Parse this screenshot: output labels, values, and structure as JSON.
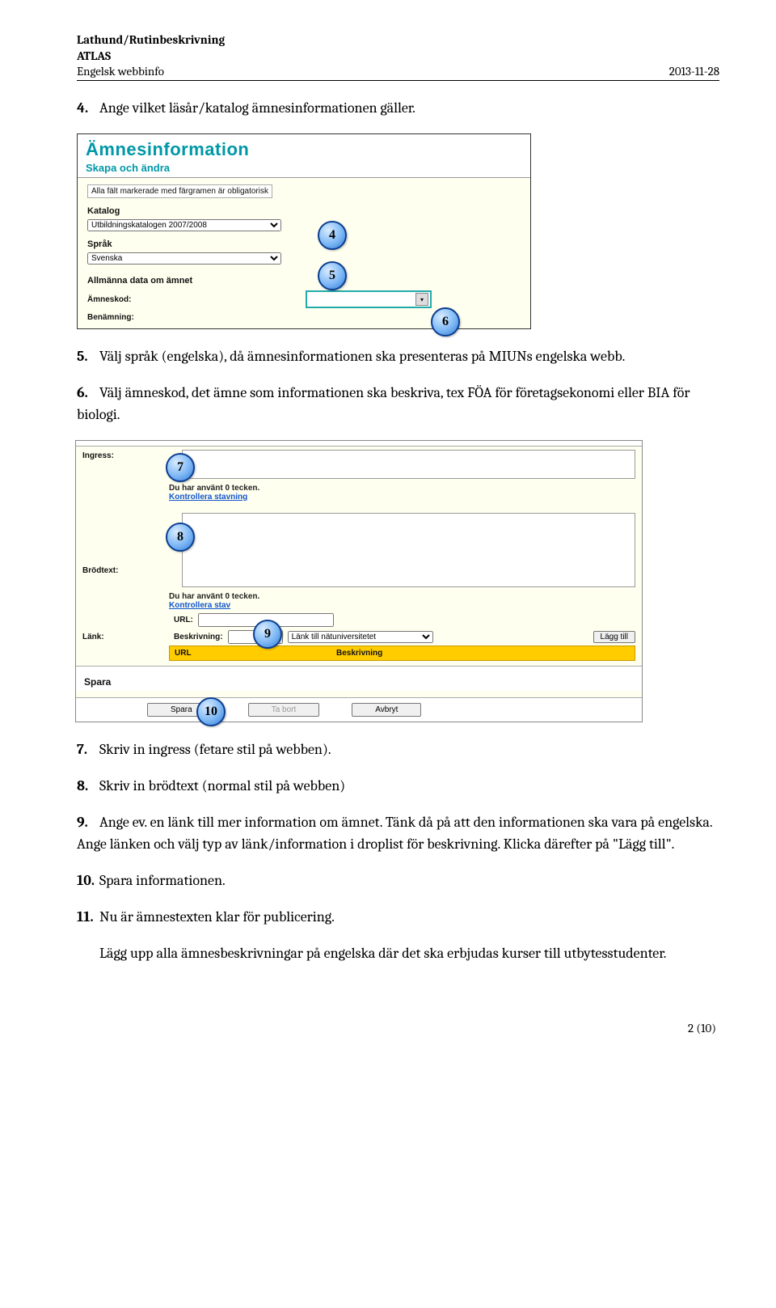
{
  "header": {
    "line1": "Lathund/Rutinbeskrivning",
    "line2": "ATLAS",
    "line3_left": "Engelsk webbinfo",
    "line3_right": "2013-11-28"
  },
  "steps": {
    "s4": {
      "num": "4.",
      "text": "Ange vilket läsår/katalog ämnesinformationen gäller."
    },
    "s5": {
      "num": "5.",
      "text": "Välj språk (engelska), då ämnesinformationen ska presenteras på MIUNs engelska webb."
    },
    "s6": {
      "num": "6.",
      "text": "Välj ämneskod, det ämne som informationen ska beskriva, tex FÖA för företagsekonomi eller BIA för biologi."
    },
    "s7": {
      "num": "7.",
      "text": "Skriv in ingress (fetare stil på webben)."
    },
    "s8": {
      "num": "8.",
      "text": "Skriv in brödtext (normal stil på webben)"
    },
    "s9": {
      "num": "9.",
      "text": "Ange ev. en länk till mer information om ämnet. Tänk då på att den informationen ska vara på engelska. Ange länken och välj typ av länk/information i droplist för beskrivning. Klicka därefter på \"Lägg till\"."
    },
    "s10": {
      "num": "10.",
      "text": "Spara informationen."
    },
    "s11": {
      "num": "11.",
      "text": "Nu är ämnestexten klar för publicering.",
      "para": "Lägg upp alla ämnesbeskrivningar på engelska där det ska erbjudas kurser till utbytesstudenter."
    }
  },
  "markers": {
    "m4": "4",
    "m5": "5",
    "m6": "6",
    "m7": "7",
    "m8": "8",
    "m9": "9",
    "m10": "10"
  },
  "ss1": {
    "title": "Ämnesinformation",
    "subtitle": "Skapa och ändra",
    "mandatory_note": "Alla fält markerade med färgramen är obligatorisk",
    "label_katalog": "Katalog",
    "value_katalog": "Utbildningskatalogen 2007/2008",
    "label_sprak": "Språk",
    "value_sprak": "Svenska",
    "section_allmanna": "Allmänna data om ämnet",
    "label_amneskod": "Ämneskod:",
    "label_benamning": "Benämning:"
  },
  "ss2": {
    "label_ingress": "Ingress:",
    "hint_used": "Du har använt 0 tecken.",
    "link_spell": "Kontrollera stavning",
    "link_spell_partial": "Kontrollera stav",
    "label_brodtext": "Brödtext:",
    "label_url": "URL:",
    "label_lank": "Länk:",
    "label_beskrivning": "Beskrivning:",
    "select_lank": "Länk till nätuniversitetet",
    "btn_laggtill": "Lägg till",
    "hdr_url": "URL",
    "hdr_beskrivning": "Beskrivning",
    "section_spara": "Spara",
    "btn_spara": "Spara",
    "btn_tabort": "Ta bort",
    "btn_avbryt": "Avbryt"
  },
  "footer": {
    "pagenum": "2 (10)"
  }
}
